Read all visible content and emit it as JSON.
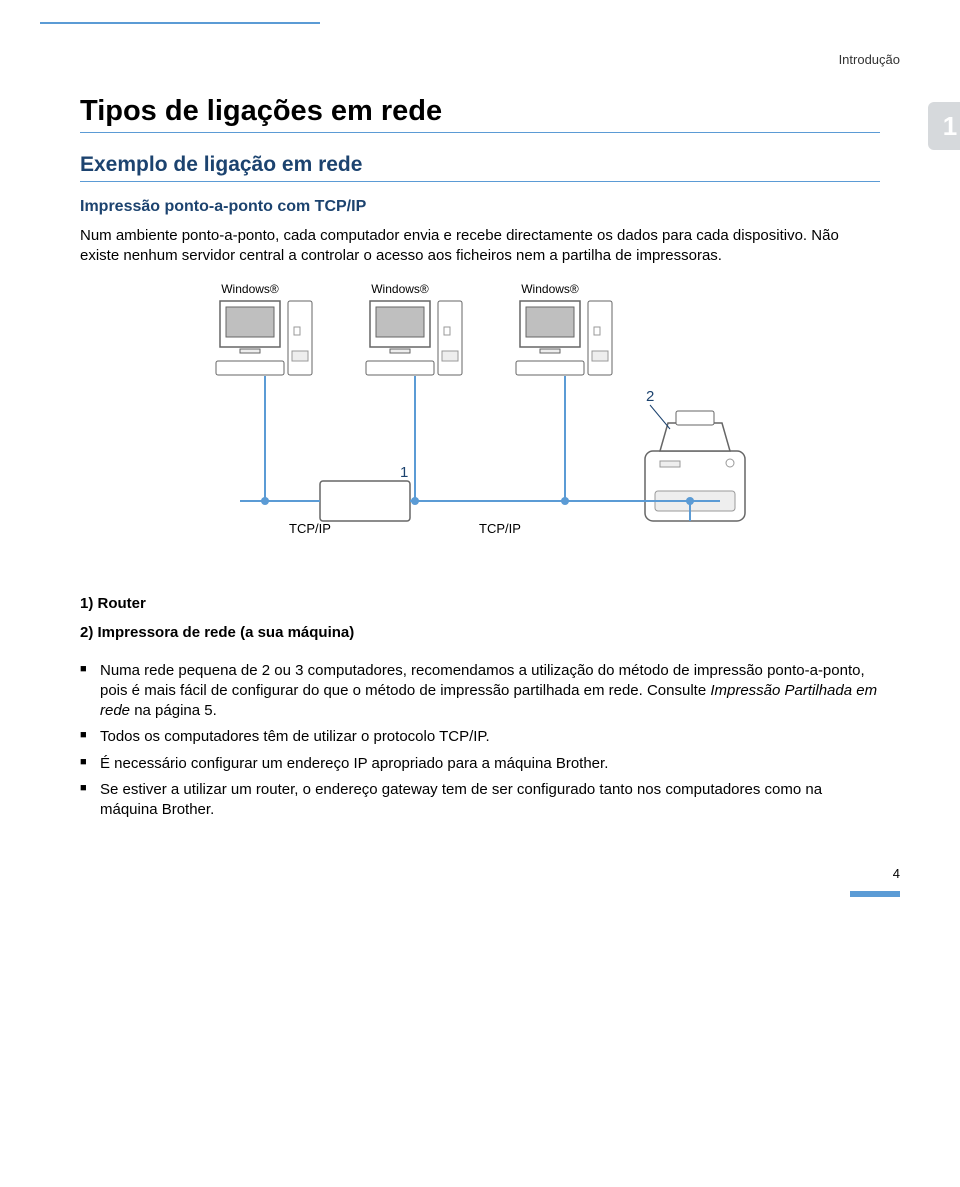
{
  "header": {
    "breadcrumb": "Introdução",
    "chapter_number": "1"
  },
  "title": "Tipos de ligações em rede",
  "subtitle": "Exemplo de ligação em rede",
  "section_title": "Impressão ponto-a-ponto com TCP/IP",
  "intro_paragraph": "Num ambiente ponto-a-ponto, cada computador envia e recebe directamente os dados para cada dispositivo. Não existe nenhum servidor central a controlar o acesso aos ficheiros nem a partilha de impressoras.",
  "diagram": {
    "pc_labels": [
      "Windows®",
      "Windows®",
      "Windows®"
    ],
    "router_num": "1",
    "printer_num": "2",
    "tcpip_left": "TCP/IP",
    "tcpip_right": "TCP/IP"
  },
  "legend": {
    "item1": "1) Router",
    "item2": "2) Impressora de rede (a sua máquina)"
  },
  "bullets": [
    {
      "text": "Numa rede pequena de 2 ou 3 computadores, recomendamos a utilização do método de impressão ponto-a-ponto, pois é mais fácil de configurar do que o método de impressão partilhada em rede. Consulte ",
      "link": "Impressão Partilhada em rede",
      "tail": " na página 5."
    },
    {
      "text": "Todos os computadores têm de utilizar o protocolo TCP/IP."
    },
    {
      "text": "É necessário configurar um endereço IP apropriado para a máquina Brother."
    },
    {
      "text": "Se estiver a utilizar um router, o endereço gateway tem de ser configurado tanto nos computadores como na máquina Brother."
    }
  ],
  "page_number": "4"
}
